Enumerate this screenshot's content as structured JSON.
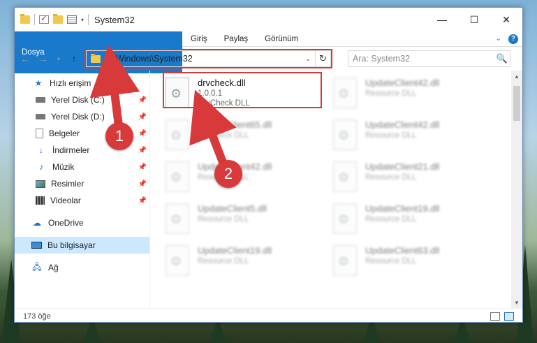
{
  "window": {
    "title": "System32",
    "controls": {
      "minimize": "—",
      "maximize": "☐",
      "close": "✕"
    }
  },
  "ribbon": {
    "tabs": [
      "Dosya",
      "Giriş",
      "Paylaş",
      "Görünüm"
    ],
    "expand_glyph": "⌄",
    "help_glyph": "?"
  },
  "nav": {
    "back": "←",
    "forward": "→",
    "recent": "▾",
    "up": "↑",
    "address": "C:\\Windows\\System32",
    "address_dropdown": "⌄",
    "refresh": "↻",
    "search_placeholder": "Ara: System32",
    "search_icon": "🔍"
  },
  "sidebar": {
    "items": [
      {
        "label": "Hızlı erişim",
        "icon": "star-icon",
        "pinned": false
      },
      {
        "label": "Yerel Disk (C:)",
        "icon": "drive-icon",
        "pinned": true
      },
      {
        "label": "Yerel Disk (D:)",
        "icon": "drive-icon",
        "pinned": true
      },
      {
        "label": "Belgeler",
        "icon": "documents-icon",
        "pinned": true
      },
      {
        "label": "İndirmeler",
        "icon": "downloads-icon",
        "pinned": true
      },
      {
        "label": "Müzik",
        "icon": "music-icon",
        "pinned": true
      },
      {
        "label": "Resimler",
        "icon": "pictures-icon",
        "pinned": true
      },
      {
        "label": "Videolar",
        "icon": "videos-icon",
        "pinned": true
      },
      {
        "label": "OneDrive",
        "icon": "cloud-icon"
      },
      {
        "label": "Bu bilgisayar",
        "icon": "computer-icon",
        "selected": true
      },
      {
        "label": "Ağ",
        "icon": "network-icon"
      }
    ],
    "pin_glyph": "📌"
  },
  "files": [
    {
      "name": "drvcheck.dll",
      "version": "1.0.0.1",
      "desc": "DrvCheck DLL",
      "highlighted": true
    },
    {
      "name": "UpdateClient42.dll",
      "desc": "Resource DLL",
      "blurred": true
    },
    {
      "name": "UpdateClient65.dll",
      "desc": "Resource DLL",
      "blurred": true
    },
    {
      "name": "UpdateClient42.dll",
      "desc": "Resource DLL",
      "blurred": true
    },
    {
      "name": "UpdateClient42.dll",
      "desc": "Resource DLL",
      "blurred": true
    },
    {
      "name": "UpdateClient21.dll",
      "desc": "Resource DLL",
      "blurred": true
    },
    {
      "name": "UpdateClient5.dll",
      "desc": "Resource DLL",
      "blurred": true
    },
    {
      "name": "UpdateClient19.dll",
      "desc": "Resource DLL",
      "blurred": true
    },
    {
      "name": "UpdateClient19.dll",
      "desc": "Resource DLL",
      "blurred": true
    },
    {
      "name": "UpdateClient63.dll",
      "desc": "Resource DLL",
      "blurred": true
    }
  ],
  "status": {
    "count": "173 öğe"
  },
  "callouts": {
    "one": "1",
    "two": "2"
  },
  "colors": {
    "accent": "#1979ca",
    "highlight": "#d33a3a",
    "selected": "#cce8ff"
  }
}
